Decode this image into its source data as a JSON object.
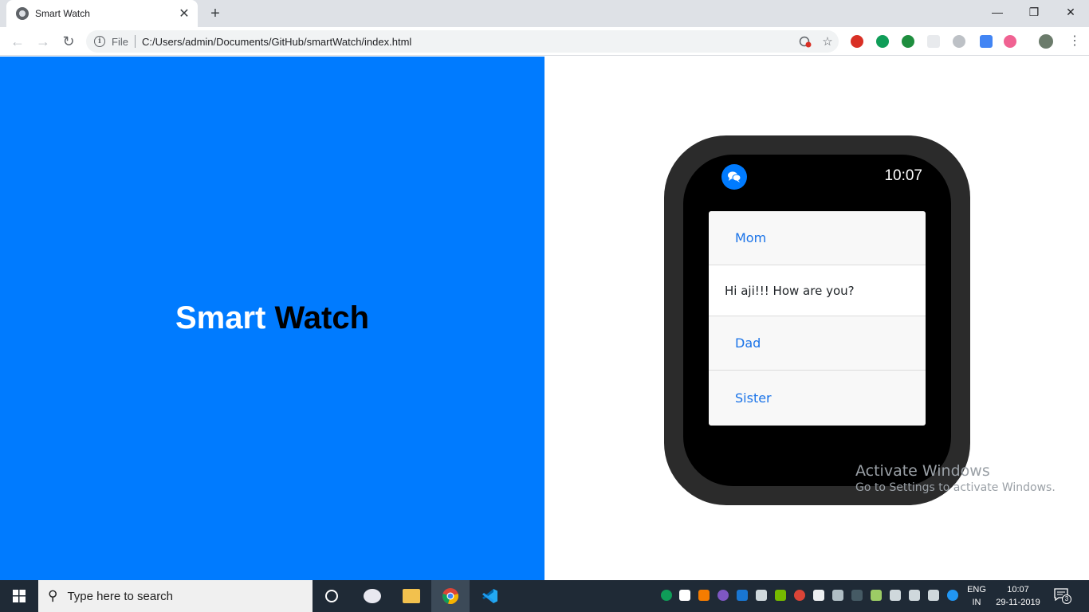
{
  "browser": {
    "tab_title": "Smart Watch",
    "new_tab": "+",
    "close_tab": "✕",
    "minimize": "—",
    "maximize": "❐",
    "close_window": "✕",
    "scheme": "File",
    "url": "C:/Users/admin/Documents/GitHub/smartWatch/index.html",
    "back": "←",
    "forward": "→",
    "reload": "↻"
  },
  "page": {
    "title_word1": "Smart",
    "title_word2": "Watch",
    "watch": {
      "time": "10:07",
      "items": [
        {
          "type": "contact",
          "label": "Mom"
        },
        {
          "type": "message",
          "label": "Hi aji!!! How are you?"
        },
        {
          "type": "contact",
          "label": "Dad"
        },
        {
          "type": "contact",
          "label": "Sister"
        }
      ]
    }
  },
  "watermark": {
    "line1": "Activate Windows",
    "line2": "Go to Settings to activate Windows."
  },
  "taskbar": {
    "search_placeholder": "Type here to search",
    "lang_line1": "ENG",
    "lang_line2": "IN",
    "time": "10:07",
    "date": "29-11-2019",
    "notification_count": "3"
  },
  "colors": {
    "left_panel": "#007bff",
    "watch_bezel": "#2b2b2b",
    "contact_text": "#1a73e8"
  }
}
